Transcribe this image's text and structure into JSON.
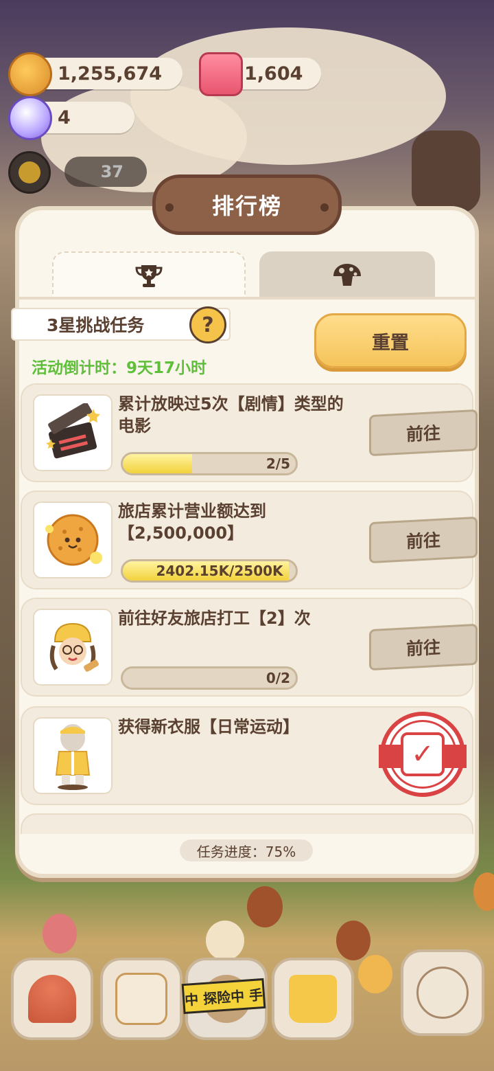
{
  "currency": {
    "coins": "1,255,674",
    "candles": "1,604",
    "gems": "4",
    "visitor_count": "37"
  },
  "panel": {
    "title": "排行榜",
    "tabs": [
      {
        "icon": "trophy-icon",
        "active": true
      },
      {
        "icon": "mushroom-icon",
        "active": false
      }
    ],
    "challenge_label": "3星挑战任务",
    "help_label": "?",
    "countdown": "活动倒计时：9天17小时",
    "reset_label": "重置",
    "tasks": [
      {
        "text": "累计放映过5次【剧情】类型的电影",
        "icon": "clapperboard-icon",
        "progress_text": "2/5",
        "progress": 0.4,
        "action": "前往",
        "completed": false
      },
      {
        "text": "旅店累计营业额达到【2,500,000】",
        "icon": "cookie-coin-icon",
        "progress_text": "2402.15K/2500K",
        "progress": 0.96,
        "action": "前往",
        "completed": false
      },
      {
        "text": "前往好友旅店打工【2】次",
        "icon": "worker-icon",
        "progress_text": "0/2",
        "progress": 0.0,
        "action": "前往",
        "completed": false
      },
      {
        "text": "获得新衣服【日常运动】",
        "icon": "outfit-icon",
        "completed": true
      }
    ],
    "overall_progress": "任务进度：75%"
  },
  "bottom_nav": {
    "explore_tag": "中 探险中 手"
  },
  "colors": {
    "accent_yellow": "#f5c45a",
    "countdown_green": "#5fbf3a",
    "stamp_red": "#d94343",
    "panel_bg": "#fbf6ec",
    "title_brown": "#8d6148"
  }
}
